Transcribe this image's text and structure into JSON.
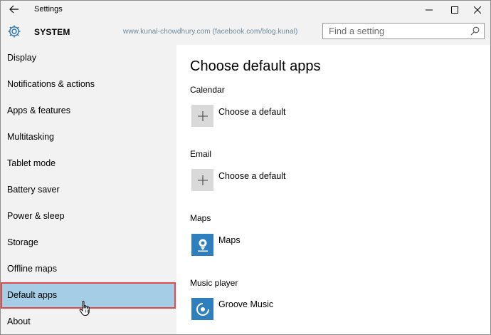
{
  "window": {
    "title": "Settings"
  },
  "header": {
    "section_title": "SYSTEM",
    "watermark": "www.kunal-chowdhury.com (facebook.com/blog.kunal)",
    "search_placeholder": "Find a setting"
  },
  "sidebar": {
    "items": [
      {
        "label": "Display"
      },
      {
        "label": "Notifications & actions"
      },
      {
        "label": "Apps & features"
      },
      {
        "label": "Multitasking"
      },
      {
        "label": "Tablet mode"
      },
      {
        "label": "Battery saver"
      },
      {
        "label": "Power & sleep"
      },
      {
        "label": "Storage"
      },
      {
        "label": "Offline maps"
      },
      {
        "label": "Default apps"
      },
      {
        "label": "About"
      }
    ],
    "selected": "Default apps"
  },
  "main": {
    "title": "Choose default apps",
    "sections": [
      {
        "label": "Calendar",
        "app": "Choose a default",
        "icon": "plus-icon"
      },
      {
        "label": "Email",
        "app": "Choose a default",
        "icon": "plus-icon"
      },
      {
        "label": "Maps",
        "app": "Maps",
        "icon": "maps-icon"
      },
      {
        "label": "Music player",
        "app": "Groove Music",
        "icon": "groove-music-icon"
      }
    ]
  },
  "colors": {
    "selected_bg": "#a6cde6",
    "highlight_border": "#e04a4a",
    "tile_blue": "#2f7fbf",
    "tile_gray": "#d9d9d9",
    "sidebar_bg": "#f2f2f2"
  }
}
